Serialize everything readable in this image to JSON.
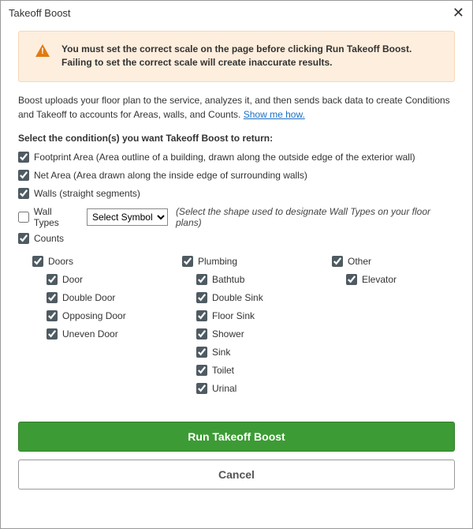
{
  "titlebar": {
    "title": "Takeoff Boost"
  },
  "alert": {
    "message": "You must set the correct scale on the page before clicking Run Takeoff Boost. Failing to set the correct scale will create inaccurate results."
  },
  "description": {
    "text": "Boost uploads your floor plan to the service, analyzes it, and then sends back data to create Conditions and Takeoff to accounts for Areas, walls, and Counts. ",
    "link": "Show me how."
  },
  "select_heading": "Select the condition(s) you want Takeoff Boost to return:",
  "conditions": {
    "footprint": {
      "label": "Footprint Area (Area outline of a building, drawn along the outside edge of the exterior wall)",
      "checked": true
    },
    "net_area": {
      "label": "Net Area (Area drawn along the inside edge of surrounding walls)",
      "checked": true
    },
    "walls": {
      "label": "Walls (straight segments)",
      "checked": true
    },
    "wall_types": {
      "label": "Wall Types",
      "checked": false,
      "select_placeholder": "Select Symbol",
      "hint": "(Select the shape used to designate Wall Types on your floor plans)"
    },
    "counts": {
      "label": "Counts",
      "checked": true
    }
  },
  "counts": {
    "col1": {
      "group": {
        "label": "Doors",
        "checked": true
      },
      "items": [
        {
          "label": "Door",
          "checked": true
        },
        {
          "label": "Double Door",
          "checked": true
        },
        {
          "label": "Opposing Door",
          "checked": true
        },
        {
          "label": "Uneven Door",
          "checked": true
        }
      ]
    },
    "col2": {
      "group": {
        "label": "Plumbing",
        "checked": true
      },
      "items": [
        {
          "label": "Bathtub",
          "checked": true
        },
        {
          "label": "Double Sink",
          "checked": true
        },
        {
          "label": "Floor Sink",
          "checked": true
        },
        {
          "label": "Shower",
          "checked": true
        },
        {
          "label": "Sink",
          "checked": true
        },
        {
          "label": "Toilet",
          "checked": true
        },
        {
          "label": "Urinal",
          "checked": true
        }
      ]
    },
    "col3": {
      "group": {
        "label": "Other",
        "checked": true
      },
      "items": [
        {
          "label": "Elevator",
          "checked": true
        }
      ]
    }
  },
  "actions": {
    "primary": "Run Takeoff Boost",
    "secondary": "Cancel"
  }
}
